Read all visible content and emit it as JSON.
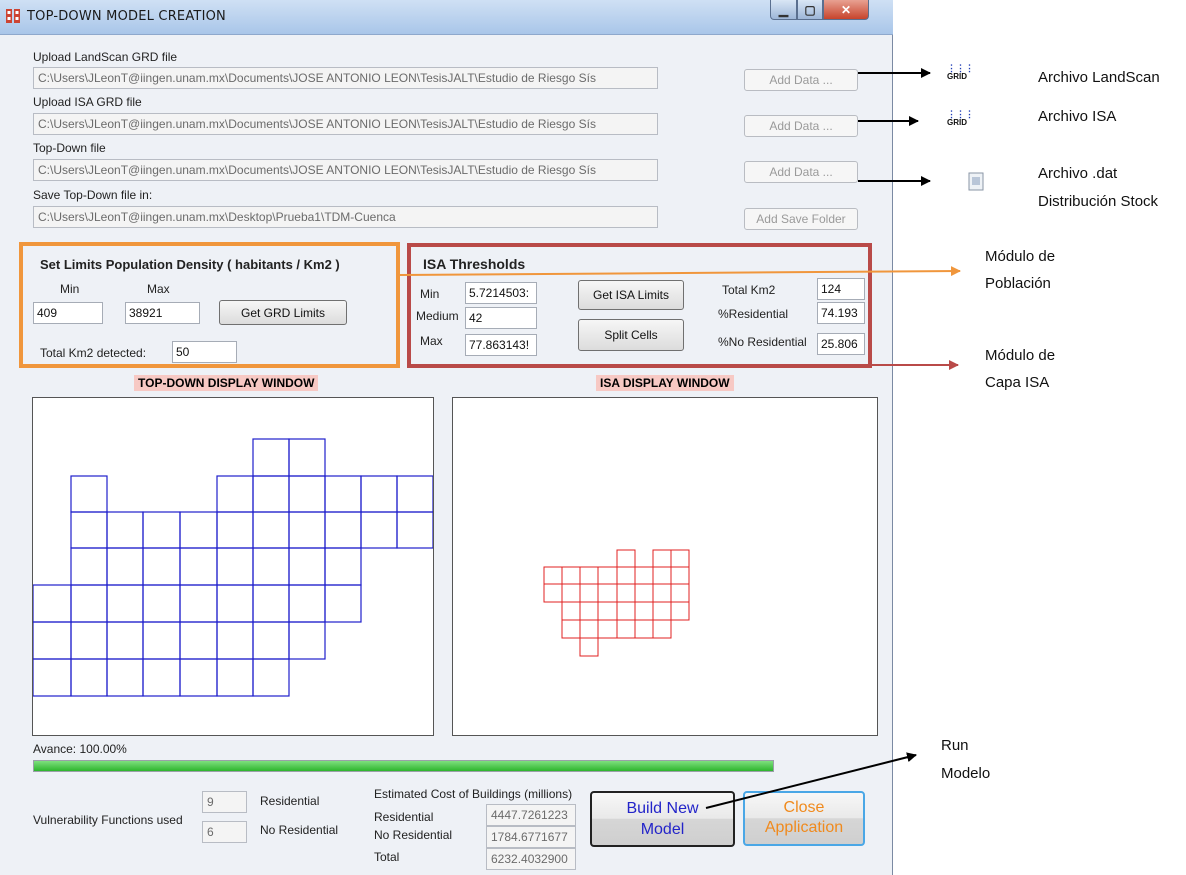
{
  "window": {
    "title": "TOP-DOWN MODEL CREATION"
  },
  "files": {
    "landscan": {
      "label": "Upload LandScan GRD file",
      "value": "C:\\Users\\JLeonT@iingen.unam.mx\\Documents\\JOSE ANTONIO LEON\\TesisJALT\\Estudio de Riesgo Sís",
      "button": "Add Data ..."
    },
    "isa": {
      "label": "Upload ISA GRD file",
      "value": "C:\\Users\\JLeonT@iingen.unam.mx\\Documents\\JOSE ANTONIO LEON\\TesisJALT\\Estudio de Riesgo Sís",
      "button": "Add Data ..."
    },
    "topdown": {
      "label": "Top-Down file",
      "value": "C:\\Users\\JLeonT@iingen.unam.mx\\Documents\\JOSE ANTONIO LEON\\TesisJALT\\Estudio de Riesgo Sís",
      "button": "Add Data ..."
    },
    "save": {
      "label": "Save Top-Down file in:",
      "value": "C:\\Users\\JLeonT@iingen.unam.mx\\Desktop\\Prueba1\\TDM-Cuenca",
      "button": "Add Save Folder"
    }
  },
  "population": {
    "title": "Set Limits Population Density ( habitants / Km2 )",
    "min_label": "Min",
    "max_label": "Max",
    "min_value": "409",
    "max_value": "38921",
    "button": "Get GRD Limits",
    "total_label": "Total Km2 detected:",
    "total_value": "50",
    "frame_color": "#f0963c"
  },
  "isa": {
    "title": "ISA Thresholds",
    "min_label": "Min",
    "medium_label": "Medium",
    "max_label": "Max",
    "min_value": "5.7214503:",
    "medium_value": "42",
    "max_value": "77.863143!",
    "button_limits": "Get ISA Limits",
    "button_split": "Split Cells",
    "total_label": "Total Km2",
    "total_value": "124",
    "res_label": "%Residential",
    "res_value": "74.193",
    "nores_label": "%No Residential",
    "nores_value": "25.806",
    "frame_color": "#b94a48"
  },
  "displays": {
    "topdown_title": "TOP-DOWN DISPLAY WINDOW",
    "isa_title": "ISA DISPLAY WINDOW",
    "topdown_grid_color": "#1f1fcc",
    "isa_grid_color": "#e02020"
  },
  "progress": {
    "label": "Avance: 100.00%",
    "fraction": 1.0,
    "color": "#3cc83c"
  },
  "vulnerability": {
    "label": "Vulnerability Functions used",
    "res_count": "9",
    "res_label": "Residential",
    "nores_count": "6",
    "nores_label": "No Residential"
  },
  "cost": {
    "title": "Estimated Cost of Buildings (millions)",
    "res_label": "Residential",
    "res_value": "4447.7261223",
    "nores_label": "No Residential",
    "nores_value": "1784.6771677",
    "total_label": "Total",
    "total_value": "6232.4032900"
  },
  "buttons": {
    "build_line1": "Build New",
    "build_line2": "Model",
    "close_line1": "Close",
    "close_line2": "Application"
  },
  "annotations": {
    "landscan": "Archivo LandScan",
    "isa": "Archivo ISA",
    "dat_line1": "Archivo .dat",
    "dat_line2": "Distribución Stock",
    "poblacion_line1": "Módulo de",
    "poblacion_line2": "Población",
    "capa_line1": "Módulo de",
    "capa_line2": "Capa ISA",
    "run_line1": "Run",
    "run_line2": "Modelo"
  },
  "icons": {
    "grd1": "grd-file-icon",
    "grd2": "grd-file-icon",
    "dat": "dat-file-icon"
  }
}
